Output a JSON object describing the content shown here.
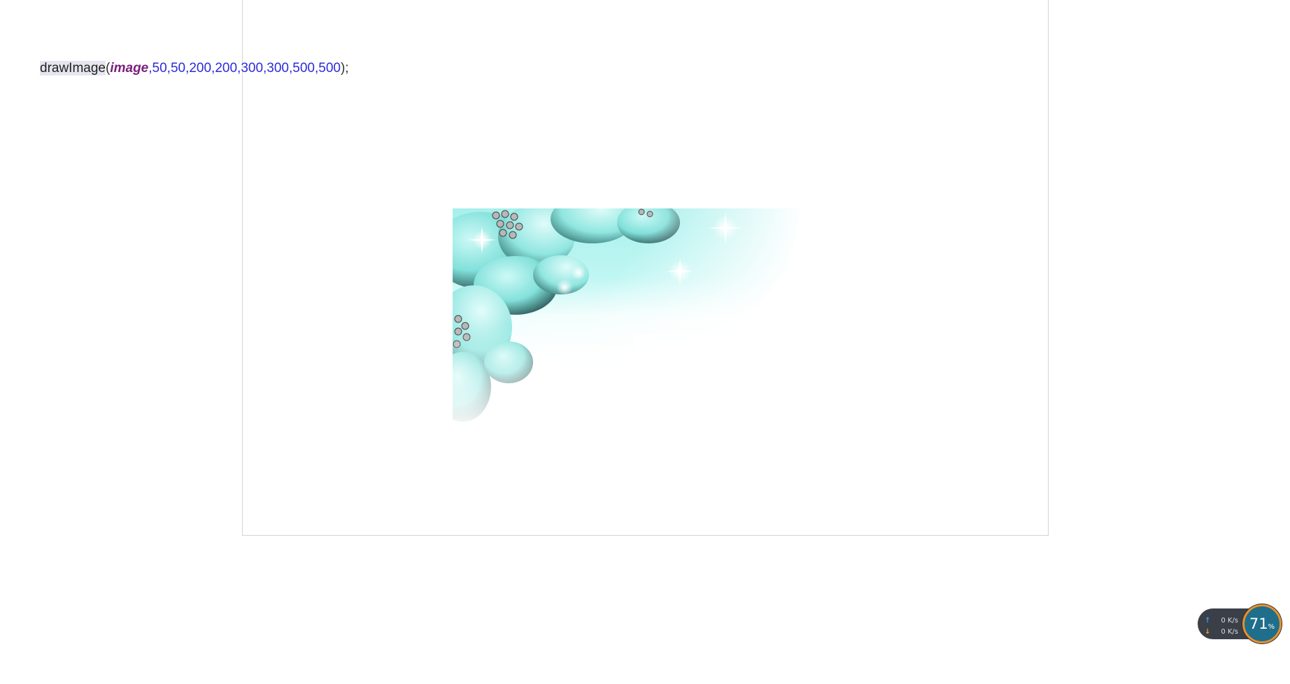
{
  "code": {
    "function": "drawImage",
    "open_paren": "(",
    "image_arg": "image",
    "args_text": ",50,50,200,200,300,300,500,500",
    "close": ");"
  },
  "canvas_image": {
    "icon": "flower-jewel-image",
    "accent_color": "#9ff0ee"
  },
  "net_monitor": {
    "upload_rate": "0 K/s",
    "download_rate": "0 K/s",
    "up_icon": "arrow-up-icon",
    "down_icon": "arrow-down-icon",
    "cpu_percent": "71",
    "cpu_unit": "%"
  }
}
